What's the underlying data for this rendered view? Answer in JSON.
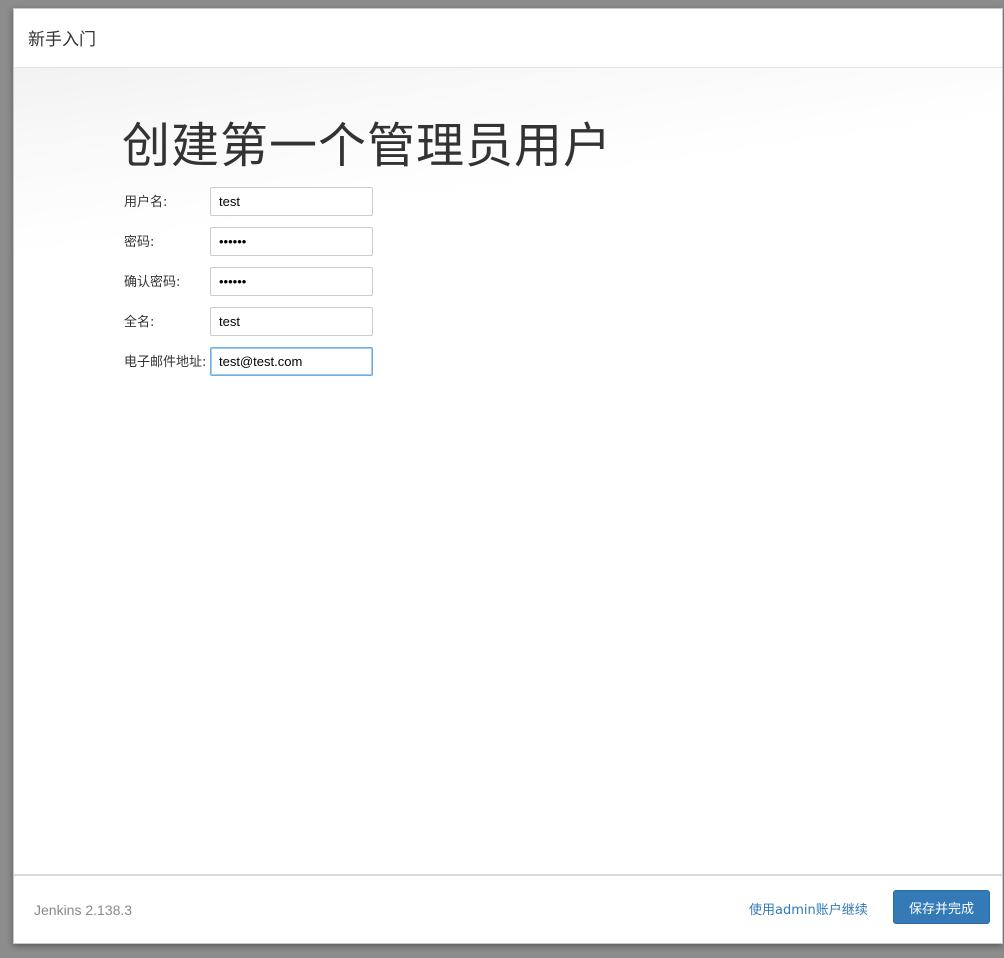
{
  "dialog": {
    "title": "新手入门"
  },
  "main": {
    "heading": "创建第一个管理员用户",
    "fields": [
      {
        "label": "用户名:",
        "value": "test",
        "type": "text"
      },
      {
        "label": "密码:",
        "value": "••••••",
        "type": "password"
      },
      {
        "label": "确认密码:",
        "value": "••••••",
        "type": "password"
      },
      {
        "label": "全名:",
        "value": "test",
        "type": "text"
      },
      {
        "label": "电子邮件地址:",
        "value": "test@test.com",
        "type": "text"
      }
    ]
  },
  "footer": {
    "version": "Jenkins 2.138.3",
    "continue_as_admin": "使用admin账户继续",
    "save_finish": "保存并完成"
  },
  "colors": {
    "accent": "#337ab7",
    "focus": "#66afe9"
  }
}
